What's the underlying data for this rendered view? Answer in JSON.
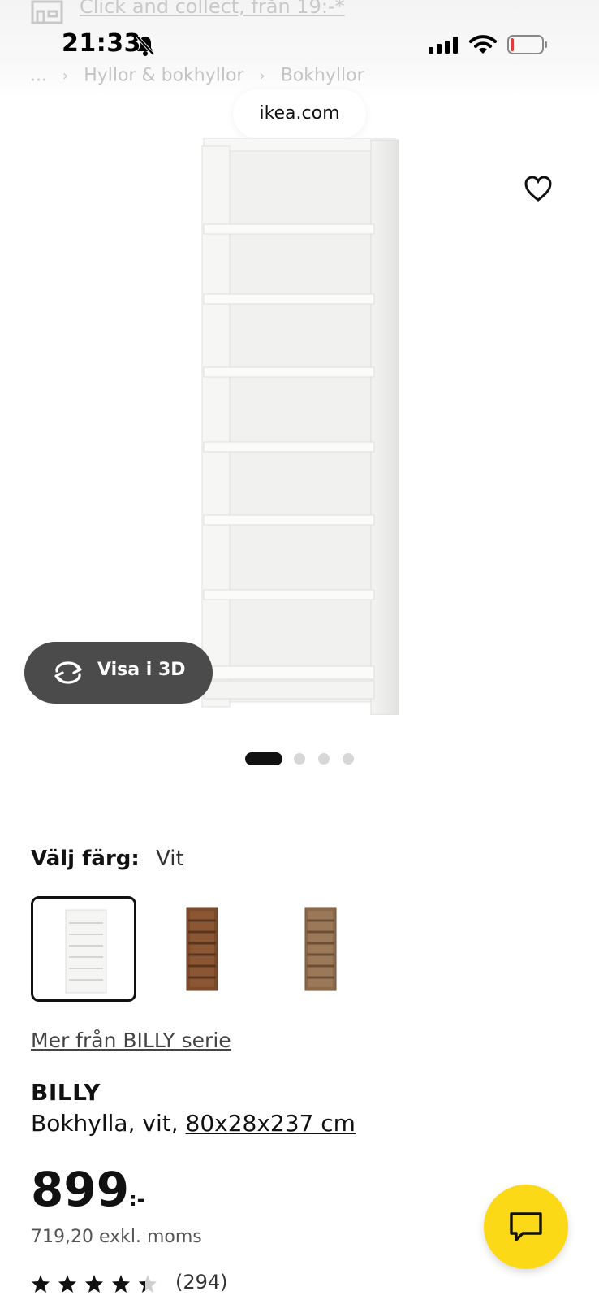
{
  "top_banner": {
    "collect_text": "Click and collect, från 19:-*"
  },
  "breadcrumb": {
    "ellipsis": "...",
    "items": [
      "Hyllor & bokhyllor",
      "Bokhyllor"
    ],
    "separator": "›"
  },
  "status_bar": {
    "time": "21:33"
  },
  "browser": {
    "url": "ikea.com"
  },
  "gallery": {
    "view_3d_label": "Visa i 3D",
    "image_count": 4,
    "active_index": 0
  },
  "color_selector": {
    "label": "Välj färg:",
    "value": "Vit",
    "variants": [
      {
        "name": "white",
        "color": "#f3f3f1",
        "selected": true
      },
      {
        "name": "brown-walnut",
        "color": "#7a4a2c",
        "selected": false
      },
      {
        "name": "oak-effect",
        "color": "#8b6a4c",
        "selected": false
      }
    ]
  },
  "series_link": "Mer från BILLY serie",
  "product": {
    "name": "BILLY",
    "description": "Bokhylla, vit, ",
    "dimensions": "80x28x237 cm",
    "price": "899",
    "price_suffix": ":-",
    "price_excl_vat": "719,20 exkl. moms",
    "rating": 4.7,
    "review_count": "(294)"
  },
  "colors": {
    "chat_button": "#fcd917",
    "view3d_button": "#4b4b4b"
  }
}
